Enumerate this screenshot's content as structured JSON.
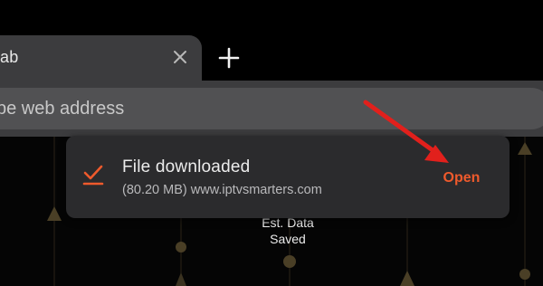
{
  "tab": {
    "title": "ab",
    "close_icon": "close-icon"
  },
  "new_tab_icon": "plus-icon",
  "omnibox": {
    "placeholder": "ype web address"
  },
  "background": {
    "label_line1": "Est. Data",
    "label_line2": "Saved"
  },
  "snackbar": {
    "icon": "download-check-icon",
    "title": "File downloaded",
    "subtitle": "(80.20 MB) www.iptvsmarters.com",
    "action": "Open"
  },
  "annotation": {
    "icon": "red-arrow-icon"
  },
  "colors": {
    "accent": "#ee5a2c",
    "arrow": "#e1201c",
    "panel": "#3c3c3e",
    "snackbar": "#2b2b2d"
  }
}
